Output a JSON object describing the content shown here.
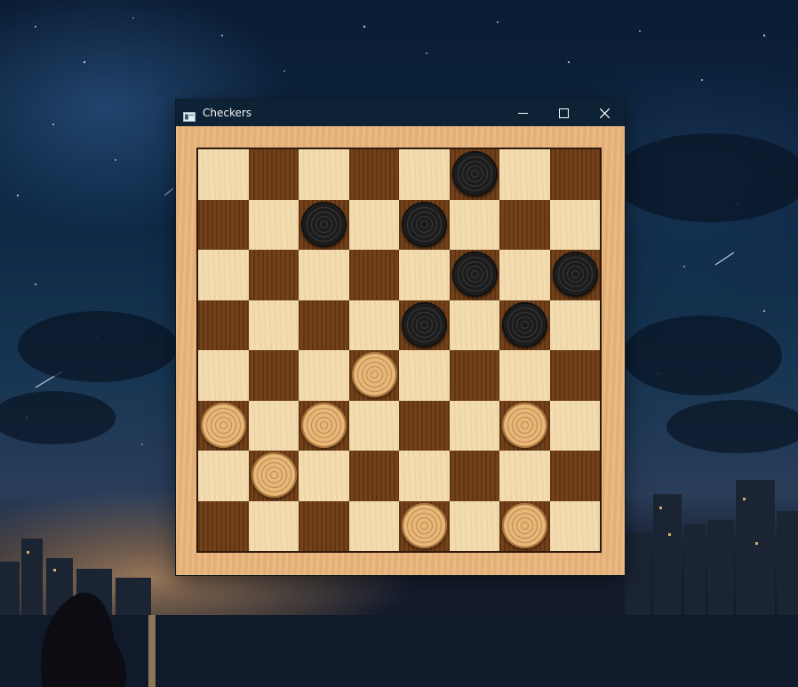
{
  "window": {
    "title": "Checkers",
    "icons": {
      "app": "app-window-icon",
      "minimize": "minimize-icon",
      "maximize": "maximize-icon",
      "close": "close-icon"
    }
  },
  "board": {
    "rows": 8,
    "cols": 8,
    "colors": {
      "light_square": "#f3dcb0",
      "dark_square": "#6e3c15",
      "frame": "#eab57b",
      "black_piece": "#1c1c1c",
      "white_piece": "#e8b77a"
    },
    "pieces": [
      {
        "row": 0,
        "col": 5,
        "color": "black"
      },
      {
        "row": 1,
        "col": 2,
        "color": "black"
      },
      {
        "row": 1,
        "col": 4,
        "color": "black"
      },
      {
        "row": 2,
        "col": 5,
        "color": "black"
      },
      {
        "row": 2,
        "col": 7,
        "color": "black"
      },
      {
        "row": 3,
        "col": 4,
        "color": "black"
      },
      {
        "row": 3,
        "col": 6,
        "color": "black"
      },
      {
        "row": 4,
        "col": 3,
        "color": "white"
      },
      {
        "row": 5,
        "col": 0,
        "color": "white"
      },
      {
        "row": 5,
        "col": 2,
        "color": "white"
      },
      {
        "row": 5,
        "col": 6,
        "color": "white"
      },
      {
        "row": 6,
        "col": 1,
        "color": "white"
      },
      {
        "row": 7,
        "col": 4,
        "color": "white"
      },
      {
        "row": 7,
        "col": 6,
        "color": "white"
      }
    ]
  }
}
